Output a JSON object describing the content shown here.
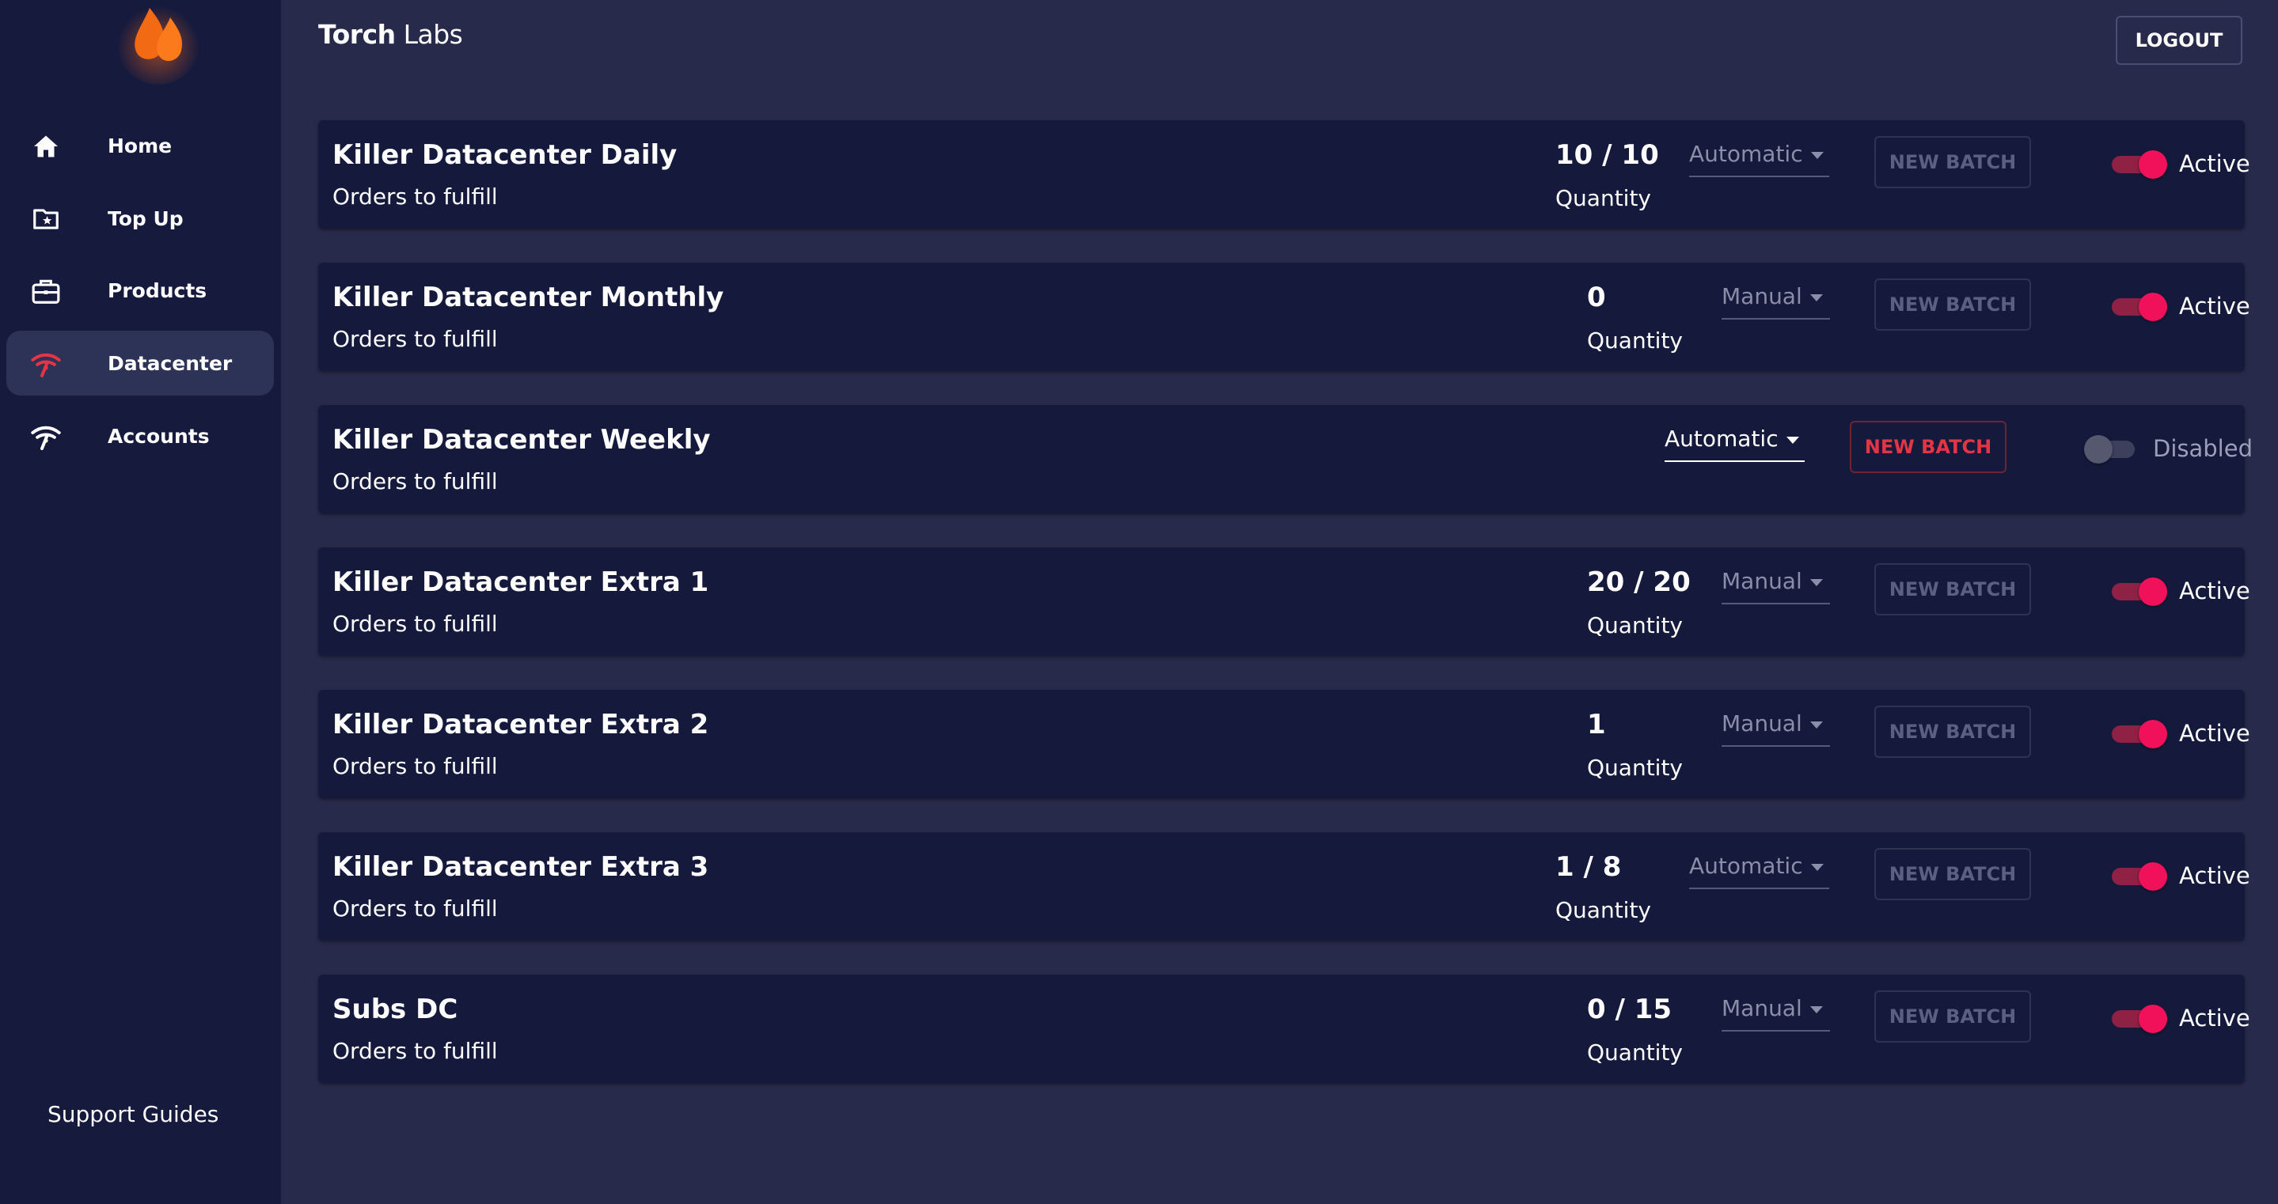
{
  "app": {
    "brand_bold": "Torch",
    "brand_rest": " Labs",
    "logout_label": "LOGOUT"
  },
  "sidebar": {
    "items": [
      {
        "label": "Home",
        "icon": "home-icon"
      },
      {
        "label": "Top Up",
        "icon": "folder-star-icon"
      },
      {
        "label": "Products",
        "icon": "briefcase-icon"
      },
      {
        "label": "Datacenter",
        "icon": "datacenter-signal-icon",
        "active": true
      },
      {
        "label": "Accounts",
        "icon": "accounts-signal-icon"
      }
    ],
    "support_label": "Support Guides"
  },
  "colors": {
    "accent": "#f0115a",
    "danger": "#e53544",
    "sidebar_bg": "#161a3d",
    "main_bg": "#272a4a",
    "card_bg": "#151a3c"
  },
  "orders": [
    {
      "title": "Killer Datacenter Daily",
      "subtitle": "Orders to fulfill",
      "quantity": "10 / 10",
      "quantity_label": "Quantity",
      "mode": "Automatic",
      "batch_label": "NEW BATCH",
      "batch_enabled": false,
      "active": true,
      "status": "Active"
    },
    {
      "title": "Killer Datacenter Monthly",
      "subtitle": "Orders to fulfill",
      "quantity": "0",
      "quantity_label": "Quantity",
      "mode": "Manual",
      "batch_label": "NEW BATCH",
      "batch_enabled": false,
      "active": true,
      "status": "Active"
    },
    {
      "title": "Killer Datacenter Weekly",
      "subtitle": "Orders to fulfill",
      "quantity": "",
      "quantity_label": "",
      "mode": "Automatic",
      "batch_label": "NEW BATCH",
      "batch_enabled": true,
      "active": false,
      "status": "Disabled"
    },
    {
      "title": "Killer Datacenter Extra 1",
      "subtitle": "Orders to fulfill",
      "quantity": "20 / 20",
      "quantity_label": "Quantity",
      "mode": "Manual",
      "batch_label": "NEW BATCH",
      "batch_enabled": false,
      "active": true,
      "status": "Active"
    },
    {
      "title": "Killer Datacenter Extra 2",
      "subtitle": "Orders to fulfill",
      "quantity": "1",
      "quantity_label": "Quantity",
      "mode": "Manual",
      "batch_label": "NEW BATCH",
      "batch_enabled": false,
      "active": true,
      "status": "Active"
    },
    {
      "title": "Killer Datacenter Extra 3",
      "subtitle": "Orders to fulfill",
      "quantity": "1 / 8",
      "quantity_label": "Quantity",
      "mode": "Automatic",
      "batch_label": "NEW BATCH",
      "batch_enabled": false,
      "active": true,
      "status": "Active"
    },
    {
      "title": "Subs DC",
      "subtitle": "Orders to fulfill",
      "quantity": "0 / 15",
      "quantity_label": "Quantity",
      "mode": "Manual",
      "batch_label": "NEW BATCH",
      "batch_enabled": false,
      "active": true,
      "status": "Active"
    }
  ]
}
